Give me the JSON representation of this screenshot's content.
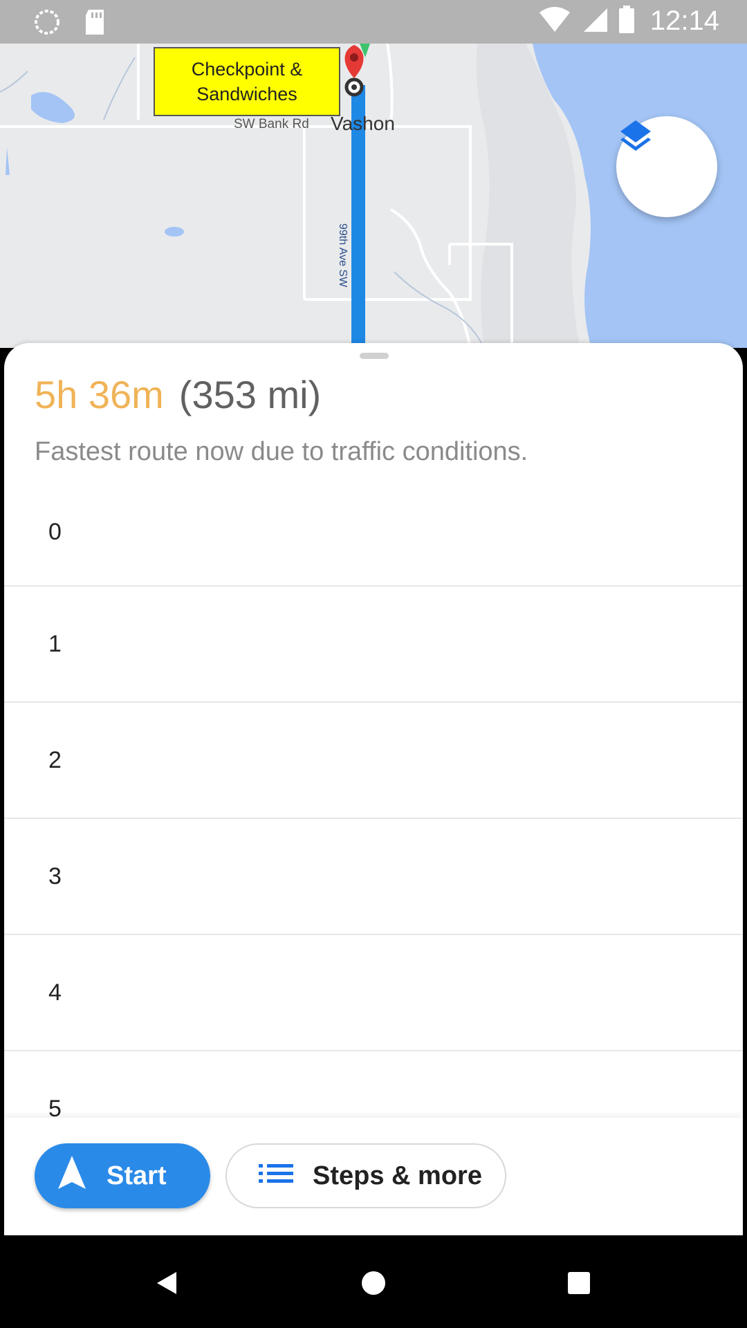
{
  "status_bar": {
    "time": "12:14",
    "icons": [
      "sync-icon",
      "sd-card-icon",
      "wifi-icon",
      "signal-icon",
      "battery-icon"
    ]
  },
  "map": {
    "poi_label": "Checkpoint &\nSandwiches",
    "road_label": "SW Bank Rd",
    "town_label": "Vashon",
    "street_label": "99th Ave SW",
    "route_color": "#1e88e5",
    "water_color": "#a3c4f5",
    "layers_icon": "layers-icon"
  },
  "route": {
    "duration": "5h 36m",
    "distance": "(353 mi)",
    "note": "Fastest route now due to traffic conditions.",
    "duration_color": "#f0b357"
  },
  "list": {
    "items": [
      "0",
      "1",
      "2",
      "3",
      "4",
      "5"
    ]
  },
  "actions": {
    "start_label": "Start",
    "steps_label": "Steps & more",
    "accent": "#2a8ae8"
  },
  "nav": {
    "icons": [
      "back-icon",
      "home-icon",
      "recents-icon"
    ]
  }
}
